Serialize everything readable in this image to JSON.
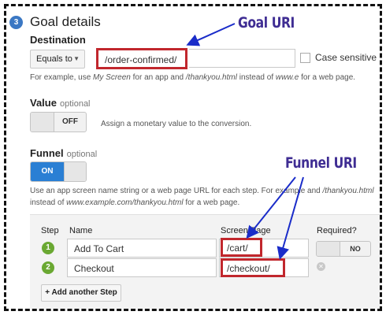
{
  "section": {
    "number": "3",
    "title": "Goal details"
  },
  "destination": {
    "label": "Destination",
    "match_type": "Equals to",
    "value": "/order-confirmed/",
    "case_sensitive_label": "Case sensitive",
    "help_parts": [
      "For example, use ",
      "My Screen",
      " for an app and ",
      "/thankyou.html",
      " instead of ",
      "www.e",
      " for a web page."
    ]
  },
  "value_field": {
    "label": "Value",
    "optional": "optional",
    "toggle": "OFF",
    "help": "Assign a monetary value to the conversion."
  },
  "funnel": {
    "label": "Funnel",
    "optional": "optional",
    "toggle": "ON",
    "help_line1_parts": [
      "Use an app screen name string or a web page URL for each step. For example",
      " and ",
      "/thankyou.html"
    ],
    "help_line2_parts": [
      "instead of ",
      "www.example.com/thankyou.html",
      " for a web page."
    ]
  },
  "steps_table": {
    "headers": {
      "step": "Step",
      "name": "Name",
      "screen_page": "Screen/Page",
      "required": "Required?"
    },
    "rows": [
      {
        "num": "1",
        "name": "Add To Cart",
        "page": "/cart/"
      },
      {
        "num": "2",
        "name": "Checkout",
        "page": "/checkout/"
      }
    ],
    "required_toggle": "NO",
    "add_step": "+ Add another Step"
  },
  "annotations": {
    "goal_uri": "Goal URI",
    "funnel_uri": "Funnel URI"
  },
  "colors": {
    "annotation": "#3f2d93",
    "highlight_box": "#c1272d",
    "toggle_on": "#2a7fd4",
    "step_badge": "#6aa832",
    "section_badge": "#3b78c4"
  }
}
